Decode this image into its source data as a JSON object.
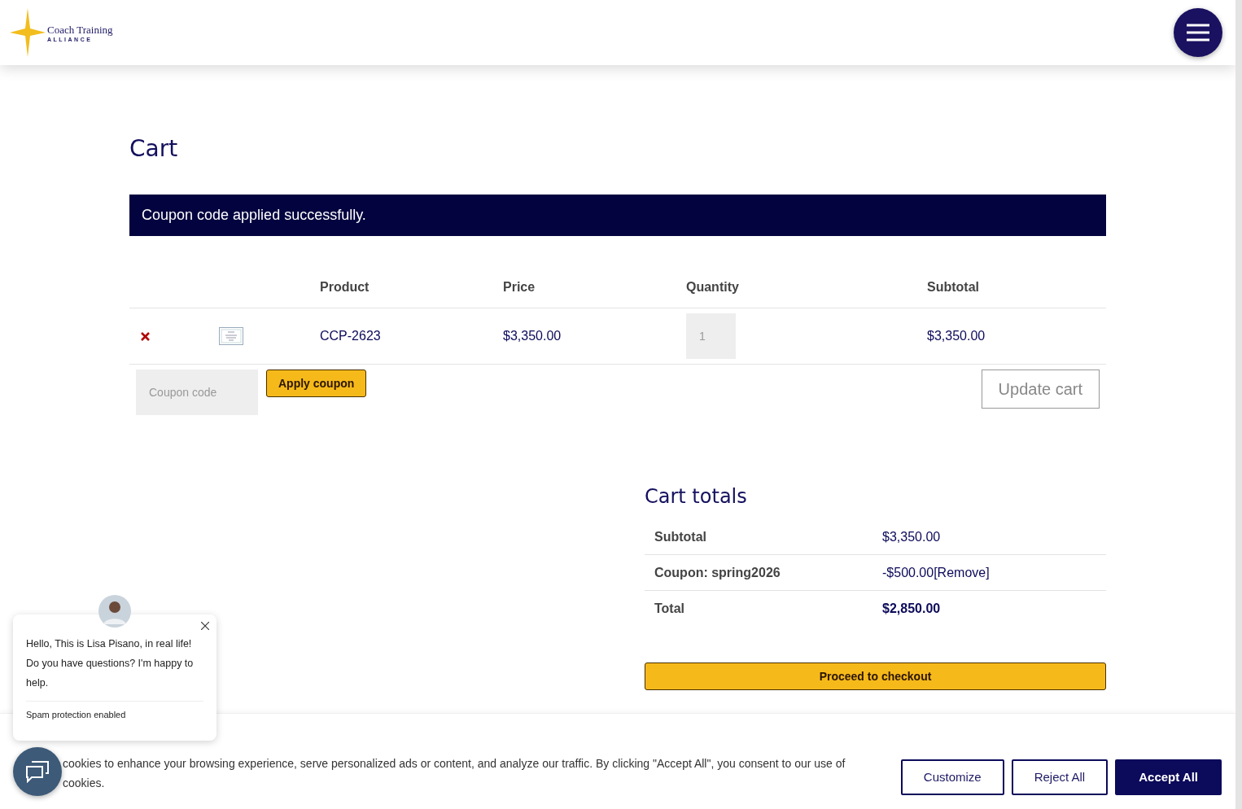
{
  "header": {
    "logo_title": "Coach Training",
    "logo_subtitle": "ALLIANCE"
  },
  "page_title": "Cart",
  "notice": "Coupon code applied successfully.",
  "cart_table": {
    "columns": [
      "Product",
      "Price",
      "Quantity",
      "Subtotal"
    ],
    "rows": [
      {
        "product": "CCP-2623",
        "price": "$3,350.00",
        "quantity": "1",
        "subtotal": "$3,350.00"
      }
    ]
  },
  "coupon": {
    "placeholder": "Coupon code",
    "apply_button": "Apply coupon"
  },
  "update_button": "Update cart",
  "totals": {
    "title": "Cart totals",
    "rows": [
      {
        "label": "Subtotal",
        "value": "$3,350.00",
        "kind": "plain"
      },
      {
        "label": "Coupon: spring2026",
        "value": "-$500.00",
        "link": "[Remove]",
        "kind": "coupon"
      },
      {
        "label": "Total",
        "value": "$2,850.00",
        "kind": "total"
      }
    ],
    "checkout_button": "Proceed to checkout"
  },
  "chat_popup": {
    "message": "Hello, This is Lisa Pisano, in real life! Do you have questions? I'm happy to help.",
    "footer": "Spam protection enabled"
  },
  "cookie_banner": {
    "text": "cookies to enhance your browsing experience, serve personalized ads or content, and analyze our traffic. By clicking \"Accept All\", you consent to our use of cookies.",
    "buttons": [
      {
        "label": "Customize",
        "kind": "outline"
      },
      {
        "label": "Reject All",
        "kind": "outline"
      },
      {
        "label": "Accept All",
        "kind": "primary"
      }
    ]
  }
}
